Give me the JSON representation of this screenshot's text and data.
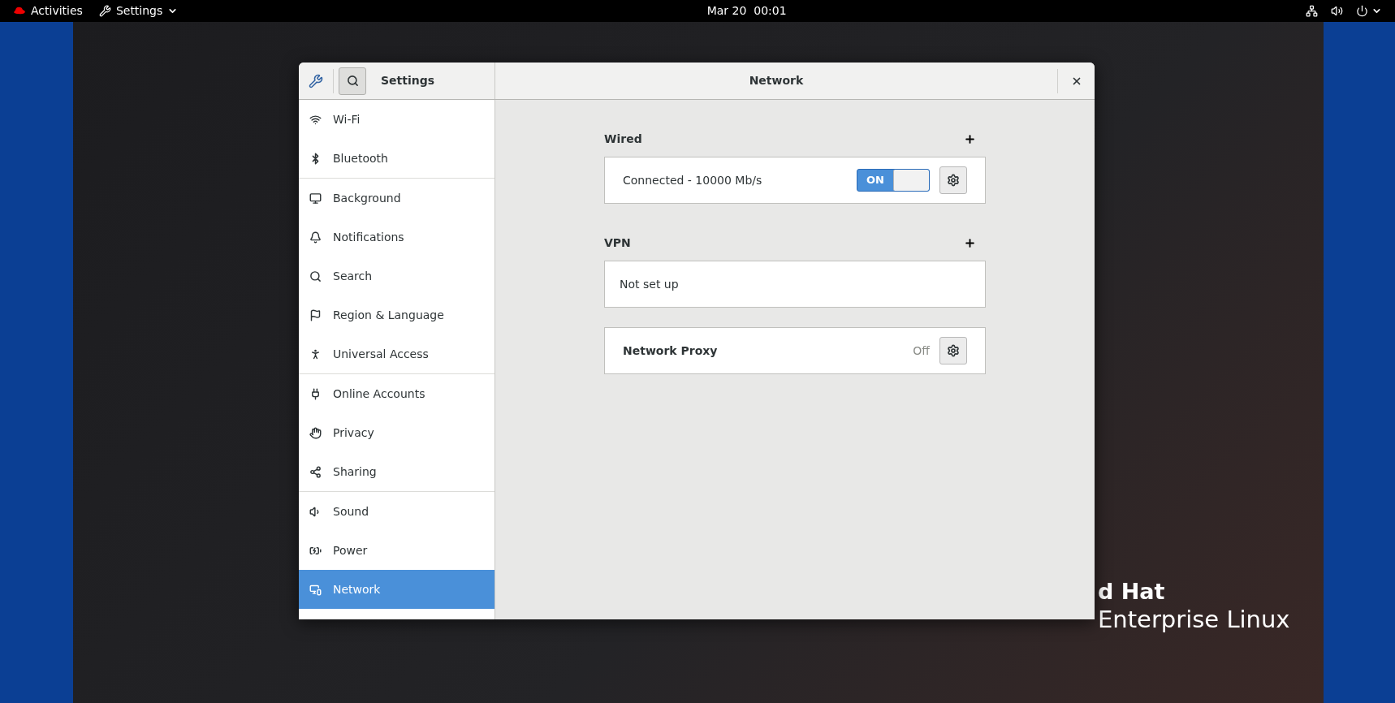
{
  "top_bar": {
    "activities": "Activities",
    "app_menu": "Settings",
    "clock": "Mar 20  00:01"
  },
  "window": {
    "sidebar_title": "Settings",
    "title": "Network"
  },
  "sidebar": {
    "groups": [
      [
        {
          "label": "Wi-Fi",
          "selected": false
        },
        {
          "label": "Bluetooth",
          "selected": false
        }
      ],
      [
        {
          "label": "Background",
          "selected": false
        },
        {
          "label": "Notifications",
          "selected": false
        },
        {
          "label": "Search",
          "selected": false
        },
        {
          "label": "Region & Language",
          "selected": false
        },
        {
          "label": "Universal Access",
          "selected": false
        }
      ],
      [
        {
          "label": "Online Accounts",
          "selected": false
        },
        {
          "label": "Privacy",
          "selected": false
        },
        {
          "label": "Sharing",
          "selected": false
        }
      ],
      [
        {
          "label": "Sound",
          "selected": false
        },
        {
          "label": "Power",
          "selected": false
        },
        {
          "label": "Network",
          "selected": true
        }
      ]
    ]
  },
  "wired": {
    "title": "Wired",
    "rows": [
      {
        "label": "Connected - 10000 Mb/s",
        "switch": {
          "on": true,
          "label": "ON"
        }
      }
    ]
  },
  "vpn": {
    "title": "VPN",
    "empty": "Not set up"
  },
  "proxy": {
    "label": "Network Proxy",
    "status": "Off"
  },
  "wallpaper": {
    "lines": [
      "d Hat",
      "Enterprise Linux"
    ]
  }
}
